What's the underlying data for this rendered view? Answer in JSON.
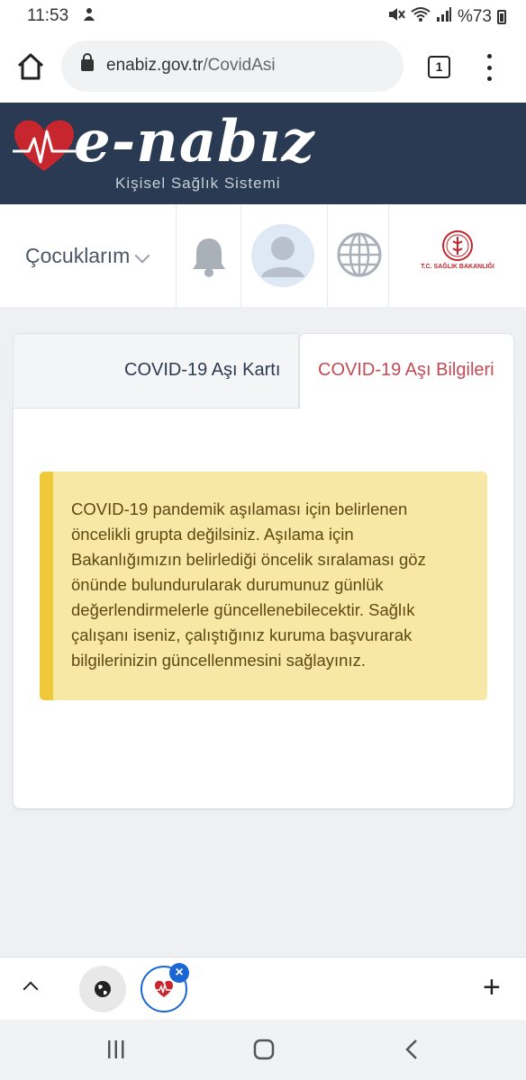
{
  "status_bar": {
    "time": "11:53",
    "battery": "%73"
  },
  "browser": {
    "url_domain": "enabiz.gov.tr",
    "url_path": "/CovidAsi",
    "tab_count": "1"
  },
  "site": {
    "logo_text": "e-nabız",
    "logo_subtitle": "Kişisel Sağlık Sistemi"
  },
  "nav": {
    "children_label": "Çocuklarım",
    "ministry_label": "T.C. SAĞLIK BAKANLIĞI"
  },
  "tabs": [
    {
      "label": "COVID-19 Aşı Kartı",
      "active": false
    },
    {
      "label": "COVID-19 Aşı Bilgileri",
      "active": true
    }
  ],
  "alert": {
    "message": "COVID-19 pandemik aşılaması için belirlenen öncelikli grupta değilsiniz. Aşılama için Bakanlığımızın belirlediği öncelik sıralaması göz önünde bulundurularak durumunuz günlük değerlendirmelerle güncellenebilecektir. Sağlık çalışanı iseniz, çalıştığınız kuruma başvurarak bilgilerinizin güncellenmesini sağlayınız."
  },
  "bottom_bar": {
    "close_symbol": "×",
    "plus_symbol": "+"
  },
  "colors": {
    "header_bg": "#2a3a52",
    "active_tab_text": "#c24b55",
    "alert_bg": "#f8e8a6",
    "alert_border": "#f0c93a",
    "alert_text": "#5c4a12",
    "accent_blue": "#1a66d2"
  }
}
